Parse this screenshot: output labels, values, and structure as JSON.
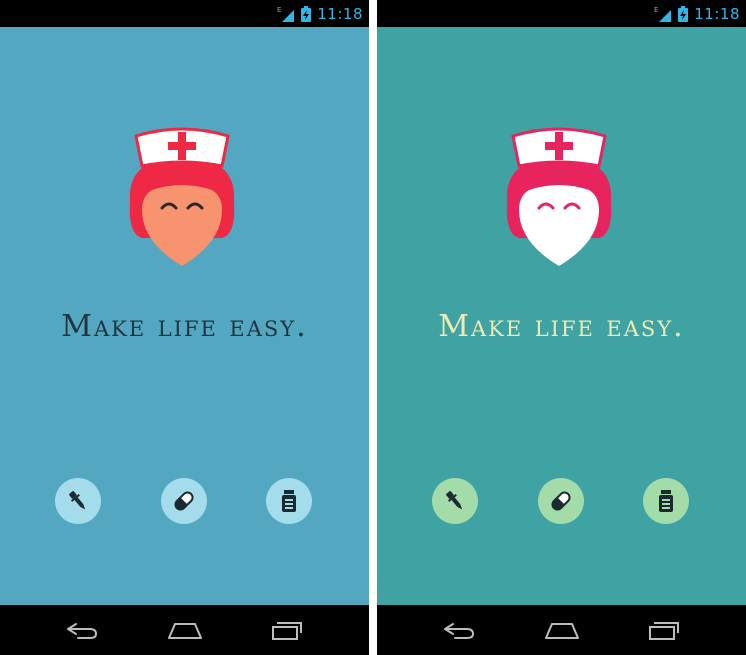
{
  "screens": [
    {
      "theme": "blue",
      "status_time": "11:18",
      "network_type": "E",
      "tagline": "Make life easy.",
      "colors": {
        "background": "#53a7c0",
        "hair": "#ef2846",
        "face": "#f7946f",
        "tagline": "#1f3540",
        "button": "#a4dceb"
      },
      "actions": [
        {
          "icon": "dropper-icon"
        },
        {
          "icon": "pill-icon"
        },
        {
          "icon": "medicine-bottle-icon"
        }
      ]
    },
    {
      "theme": "teal",
      "status_time": "11:18",
      "network_type": "E",
      "tagline": "Make life easy.",
      "colors": {
        "background": "#3fa3a3",
        "hair": "#e8245e",
        "face": "#ffffff",
        "tagline": "#f2e9b0",
        "button": "#a3dca9"
      },
      "actions": [
        {
          "icon": "dropper-icon"
        },
        {
          "icon": "pill-icon"
        },
        {
          "icon": "medicine-bottle-icon"
        }
      ]
    }
  ],
  "navigation": [
    "back-icon",
    "home-icon",
    "recent-apps-icon"
  ]
}
